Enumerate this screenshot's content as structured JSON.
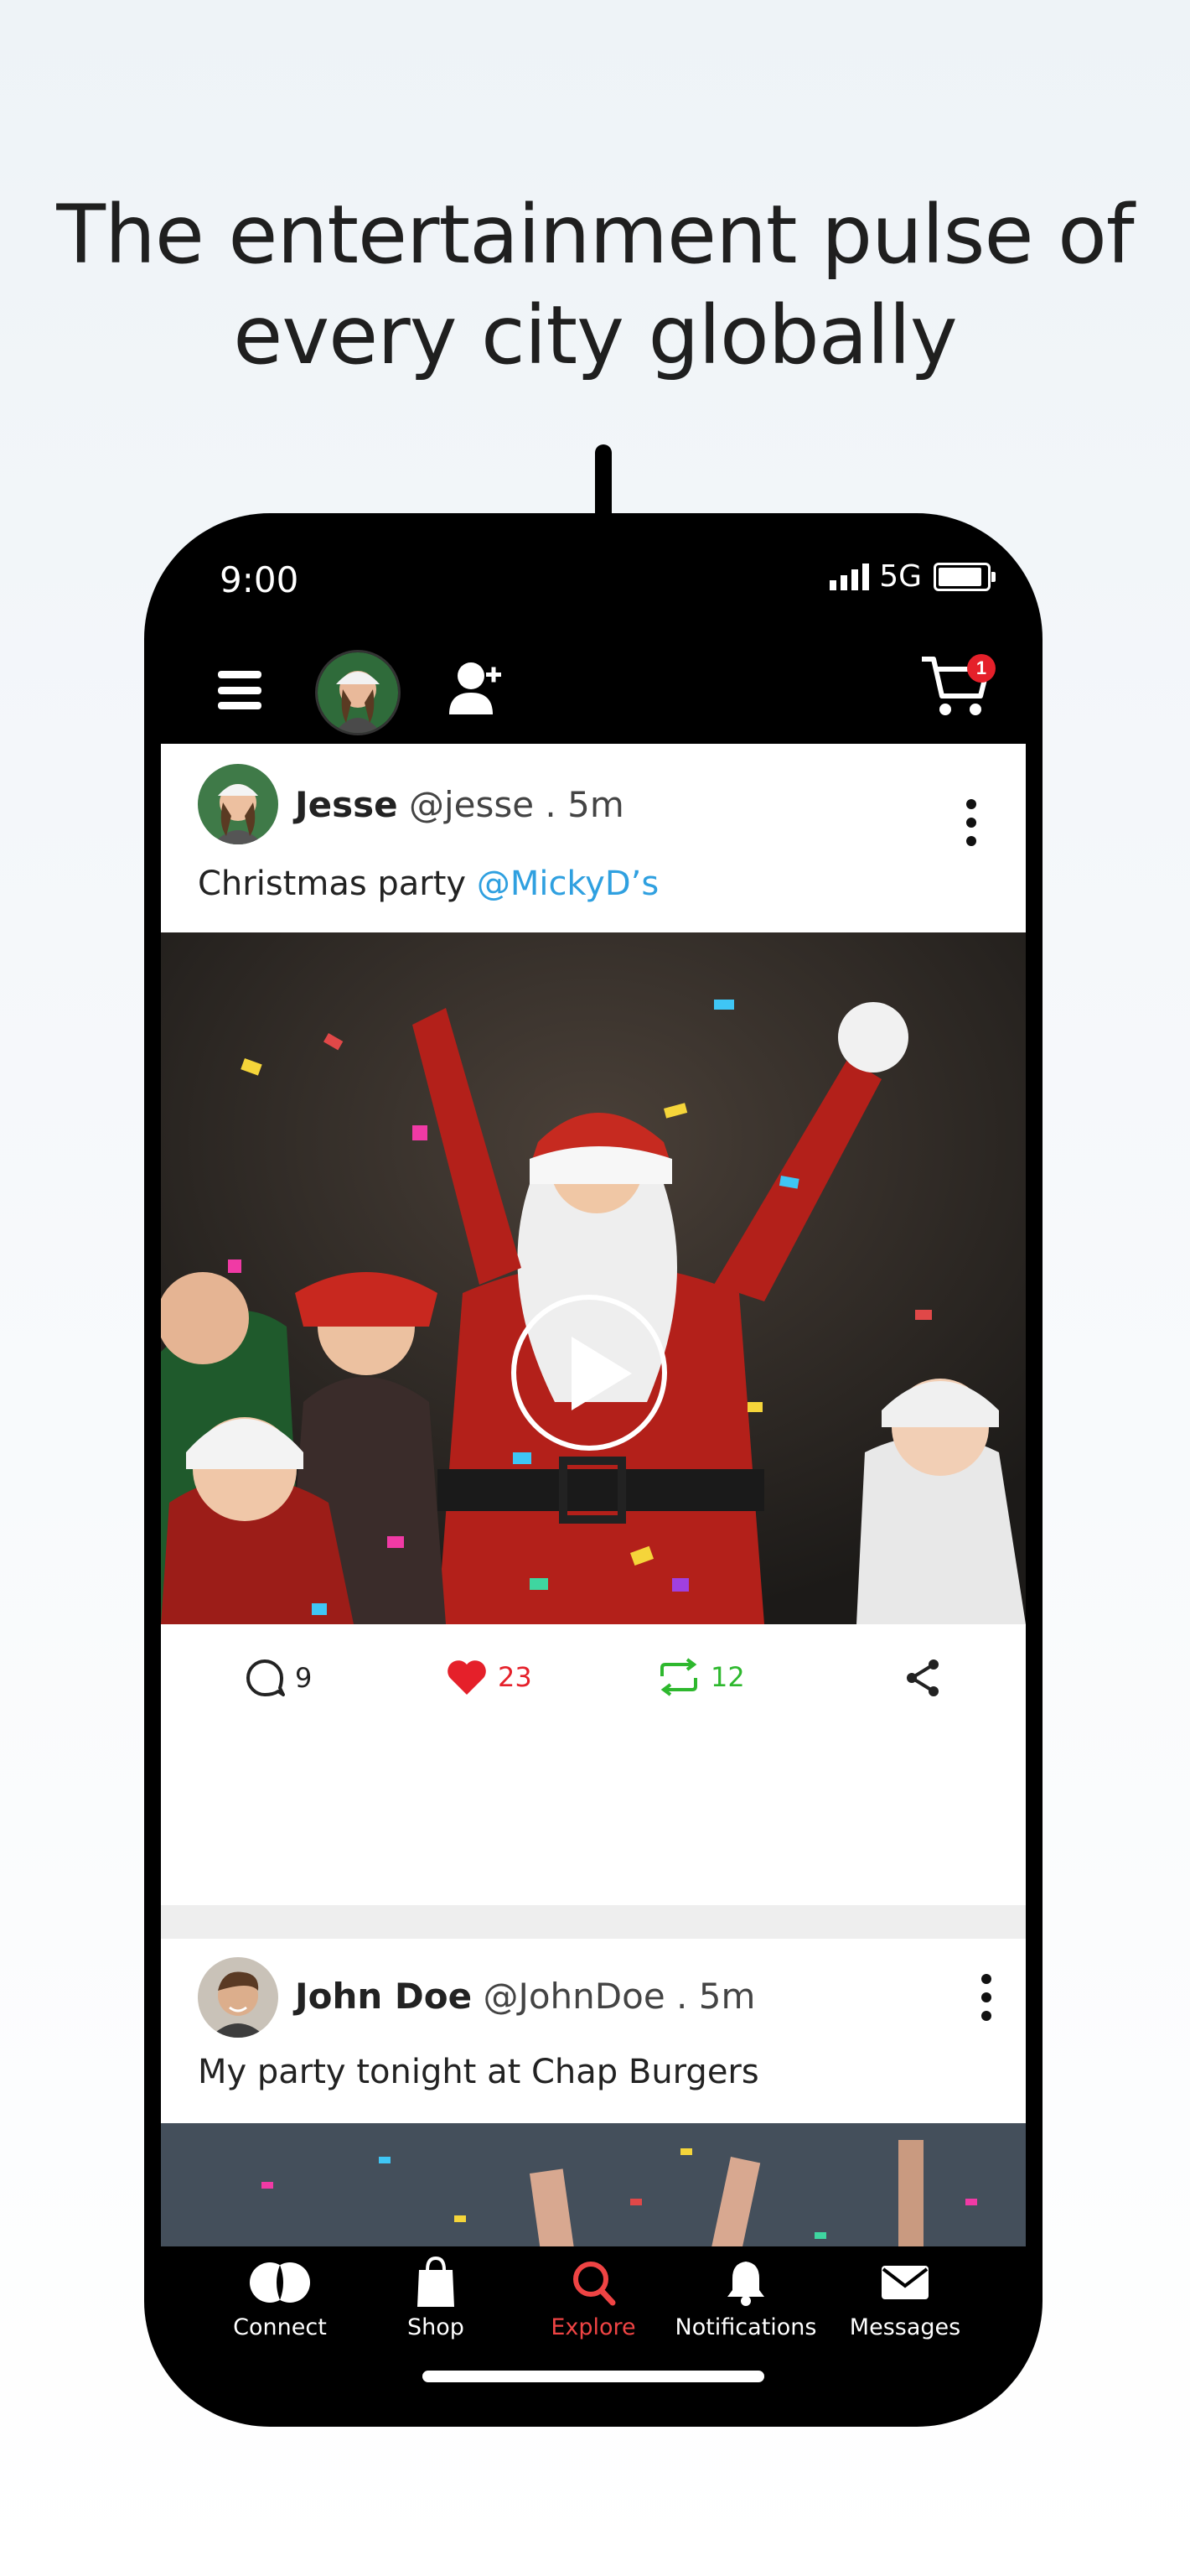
{
  "headline": {
    "line1": "The entertainment pulse of",
    "line2": "every city globally"
  },
  "status_bar": {
    "time": "9:00",
    "network": "5G"
  },
  "top_bar": {
    "cart_count": "1"
  },
  "posts": [
    {
      "name": "Jesse",
      "handle": "@jesse . 5m",
      "text": "Christmas party ",
      "mention": "@MickyD’s",
      "comments": "9",
      "likes": "23",
      "reposts": "12"
    },
    {
      "name": "John Doe",
      "handle": "@JohnDoe . 5m",
      "text": "My party tonight at Chap Burgers"
    }
  ],
  "tabs": [
    {
      "label": "Connect",
      "icon": "connect-icon"
    },
    {
      "label": "Shop",
      "icon": "shopping-bag-icon"
    },
    {
      "label": "Explore",
      "icon": "search-icon"
    },
    {
      "label": "Notifications",
      "icon": "bell-icon"
    },
    {
      "label": "Messages",
      "icon": "envelope-icon"
    }
  ],
  "colors": {
    "accent": "#ef4444",
    "mention": "#2fa0e0",
    "like": "#e5202a",
    "repost": "#2eb82e",
    "badge": "#e5202a"
  }
}
